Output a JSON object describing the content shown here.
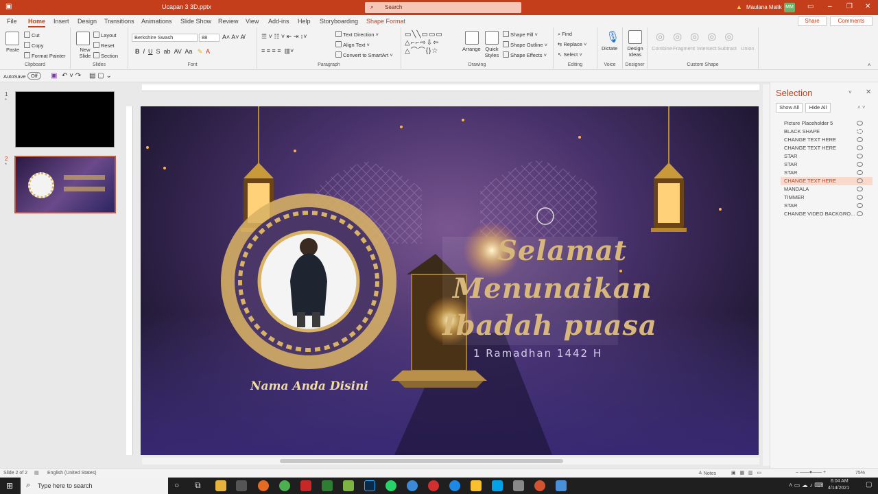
{
  "app": {
    "doc_title": "Ucapan 3 3D.pptx",
    "search_placeholder": "Search",
    "user_name": "Maulana Malik",
    "user_initials": "MM"
  },
  "tabs": [
    "File",
    "Home",
    "Insert",
    "Design",
    "Transitions",
    "Animations",
    "Slide Show",
    "Review",
    "View",
    "Add-ins",
    "Help",
    "Storyboarding",
    "Shape Format"
  ],
  "actions": {
    "share": "Share",
    "comments": "Comments"
  },
  "ribbon": {
    "clipboard": {
      "label": "Clipboard",
      "paste": "Paste",
      "cut": "Cut",
      "copy": "Copy",
      "format_painter": "Format Painter"
    },
    "slides": {
      "label": "Slides",
      "new_slide": "New Slide",
      "layout": "Layout",
      "reset": "Reset",
      "section": "Section"
    },
    "font": {
      "label": "Font",
      "family": "Berkshire Swash",
      "size": "88"
    },
    "paragraph": {
      "label": "Paragraph",
      "text_direction": "Text Direction",
      "align_text": "Align Text",
      "smartart": "Convert to SmartArt"
    },
    "drawing": {
      "label": "Drawing",
      "arrange": "Arrange",
      "quick_styles": "Quick Styles",
      "shape_fill": "Shape Fill",
      "shape_outline": "Shape Outline",
      "shape_effects": "Shape Effects"
    },
    "editing": {
      "label": "Editing",
      "find": "Find",
      "replace": "Replace",
      "select": "Select"
    },
    "voice": {
      "label": "Voice",
      "dictate": "Dictate"
    },
    "designer": {
      "label": "Designer",
      "design_ideas": "Design Ideas"
    },
    "custom_shape": {
      "label": "Custom Shape",
      "items": [
        "Combine",
        "Fragment",
        "Intersect",
        "Subtract",
        "Union"
      ]
    }
  },
  "qat": {
    "autosave": "AutoSave",
    "autosave_state": "Off"
  },
  "thumbnails": {
    "slide1": "1",
    "slide2": "2"
  },
  "slide": {
    "line1": "Selamat",
    "line2": "Menunaikan",
    "line3": "Ibadah puasa",
    "date": "1 Ramadhan 1442 H",
    "name": "Nama Anda Disini"
  },
  "selection_pane": {
    "title": "Selection",
    "show_all": "Show All",
    "hide_all": "Hide All",
    "items": [
      "Picture Placeholder 5",
      "BLACK SHAPE",
      "CHANGE TEXT HERE",
      "CHANGE TEXT HERE",
      "STAR",
      "STAR",
      "STAR",
      "CHANGE TEXT HERE",
      "MANDALA",
      "TIMMER",
      "STAR",
      "CHANGE VIDEO BACKGRO..."
    ]
  },
  "status": {
    "slide": "Slide 2 of 2",
    "language": "English (United States)",
    "notes": "Notes",
    "zoom": "75%"
  },
  "taskbar": {
    "search": "Type here to search",
    "time": "6:04 AM",
    "date": "4/14/2021"
  },
  "colors": {
    "accent": "#c43e1c",
    "gold": "#d8b265"
  }
}
